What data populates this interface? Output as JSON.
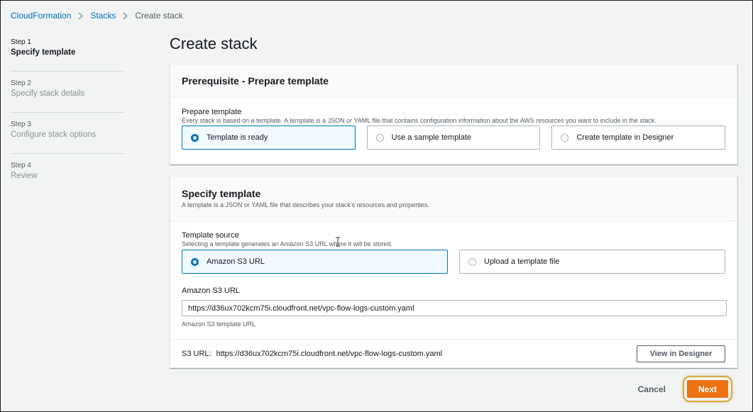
{
  "breadcrumb": {
    "items": [
      "CloudFormation",
      "Stacks"
    ],
    "current": "Create stack"
  },
  "steps": [
    {
      "num": "Step 1",
      "title": "Specify template"
    },
    {
      "num": "Step 2",
      "title": "Specify stack details"
    },
    {
      "num": "Step 3",
      "title": "Configure stack options"
    },
    {
      "num": "Step 4",
      "title": "Review"
    }
  ],
  "page_title": "Create stack",
  "prerequisite": {
    "title": "Prerequisite - Prepare template",
    "field_label": "Prepare template",
    "field_desc": "Every stack is based on a template. A template is a JSON or YAML file that contains configuration information about the AWS resources you want to include in the stack.",
    "options": [
      "Template is ready",
      "Use a sample template",
      "Create template in Designer"
    ],
    "selected": "Template is ready"
  },
  "specify_template": {
    "title": "Specify template",
    "desc": "A template is a JSON or YAML file that describes your stack's resources and properties.",
    "source_label": "Template source",
    "source_desc": "Selecting a template generates an Amazon S3 URL where it will be stored.",
    "source_options": [
      "Amazon S3 URL",
      "Upload a template file"
    ],
    "selected": "Amazon S3 URL",
    "s3_label": "Amazon S3 URL",
    "s3_value": "https://d36ux702kcm75i.cloudfront.net/vpc-flow-logs-custom.yaml",
    "s3_hint": "Amazon S3 template URL",
    "s3_url_prefix": "S3 URL:",
    "s3_url_value": "https://d36ux702kcm75i.cloudfront.net/vpc-flow-logs-custom.yaml",
    "view_designer_label": "View in Designer"
  },
  "actions": {
    "cancel_label": "Cancel",
    "next_label": "Next"
  },
  "colors": {
    "link": "#0073bb",
    "primary": "#ec7211",
    "highlight": "#d9a93a"
  }
}
